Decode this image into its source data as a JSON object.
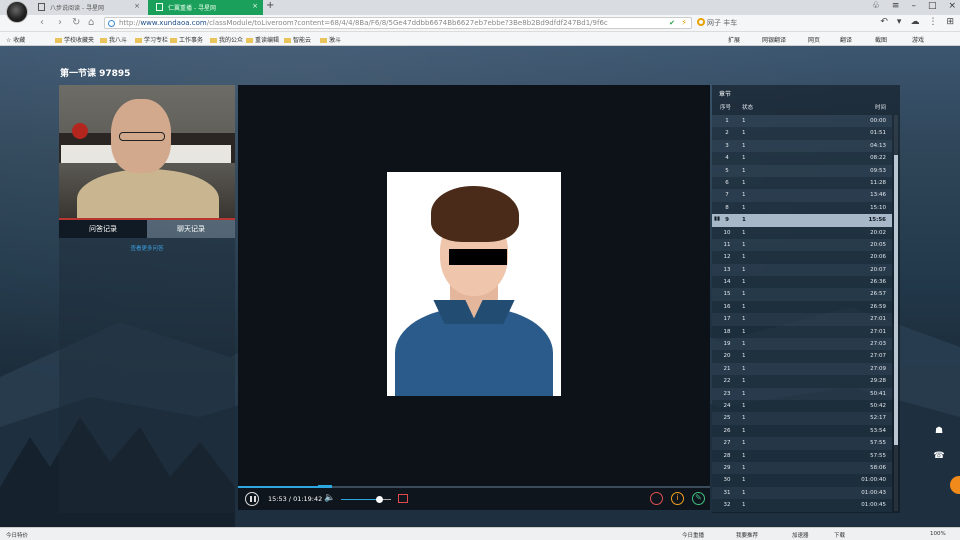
{
  "browser": {
    "tabs": [
      {
        "label": "八步说阅读 - 寻星网",
        "active": false
      },
      {
        "label": "仁翼重播 - 寻星网",
        "active": true
      }
    ],
    "new_tab_label": "+",
    "url_host": "www.xundaoa.com",
    "url_prefix": "http://",
    "url_path": "/classModule/toLiveroom?content=68/4/4/8Ba/F6/8/5Ge47ddbb6674Bb6627eb7ebbe?3Be8b2Bd9dfdf247Bd1/9f6c",
    "search_text": "网子  丰车",
    "bookmarks": [
      "收藏",
      "学校收藏夹",
      "我八斗",
      "学习专栏",
      "工作事务",
      "我的公众",
      "重读编辑",
      "智能云",
      "激斗"
    ],
    "bookmarks_right": [
      "扩展",
      "网银翻译",
      "网页",
      "翻译",
      "截图",
      "游戏"
    ]
  },
  "page": {
    "title": "第一节课 97895",
    "side_tabs": [
      "问答记录",
      "聊天记录"
    ],
    "side_link": "查看更多问答",
    "player": {
      "time_current": "15:53",
      "time_total": "01:19:42",
      "progress_percent": 19.9,
      "volume_percent": 75
    },
    "playlist": {
      "title": "章节",
      "headers": {
        "num": "序号",
        "status": "状态",
        "time": "时间"
      },
      "current_index": 9,
      "rows": [
        {
          "num": "1",
          "status": "1",
          "time": "00:00"
        },
        {
          "num": "2",
          "status": "1",
          "time": "01:51"
        },
        {
          "num": "3",
          "status": "1",
          "time": "04:13"
        },
        {
          "num": "4",
          "status": "1",
          "time": "08:22"
        },
        {
          "num": "5",
          "status": "1",
          "time": "09:53"
        },
        {
          "num": "6",
          "status": "1",
          "time": "11:28"
        },
        {
          "num": "7",
          "status": "1",
          "time": "13:46"
        },
        {
          "num": "8",
          "status": "1",
          "time": "15:10"
        },
        {
          "num": "9",
          "status": "1",
          "time": "15:56"
        },
        {
          "num": "10",
          "status": "1",
          "time": "20:02"
        },
        {
          "num": "11",
          "status": "1",
          "time": "20:05"
        },
        {
          "num": "12",
          "status": "1",
          "time": "20:06"
        },
        {
          "num": "13",
          "status": "1",
          "time": "20:07"
        },
        {
          "num": "14",
          "status": "1",
          "time": "26:36"
        },
        {
          "num": "15",
          "status": "1",
          "time": "26:57"
        },
        {
          "num": "16",
          "status": "1",
          "time": "26:59"
        },
        {
          "num": "17",
          "status": "1",
          "time": "27:01"
        },
        {
          "num": "18",
          "status": "1",
          "time": "27:01"
        },
        {
          "num": "19",
          "status": "1",
          "time": "27:03"
        },
        {
          "num": "20",
          "status": "1",
          "time": "27:07"
        },
        {
          "num": "21",
          "status": "1",
          "time": "27:09"
        },
        {
          "num": "22",
          "status": "1",
          "time": "29:28"
        },
        {
          "num": "23",
          "status": "1",
          "time": "50:41"
        },
        {
          "num": "24",
          "status": "1",
          "time": "50:42"
        },
        {
          "num": "25",
          "status": "1",
          "time": "52:17"
        },
        {
          "num": "26",
          "status": "1",
          "time": "53:54"
        },
        {
          "num": "27",
          "status": "1",
          "time": "57:55"
        },
        {
          "num": "28",
          "status": "1",
          "time": "57:55"
        },
        {
          "num": "29",
          "status": "1",
          "time": "58:06"
        },
        {
          "num": "30",
          "status": "1",
          "time": "01:00:40"
        },
        {
          "num": "31",
          "status": "1",
          "time": "01:00:43"
        },
        {
          "num": "32",
          "status": "1",
          "time": "01:00:45"
        }
      ]
    }
  },
  "statusbar": {
    "left": "今日特价",
    "items": [
      "今日重播",
      "我要推荐",
      "加速器",
      "下载",
      "100%"
    ]
  },
  "colors": {
    "accent": "#2ea6e0",
    "active_tab": "#1aa05a",
    "record_red": "#e14a4a",
    "orange": "#f08a1b"
  }
}
